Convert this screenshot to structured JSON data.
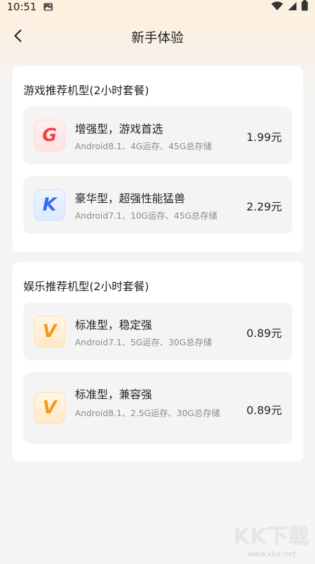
{
  "status_bar": {
    "time": "10:51"
  },
  "header": {
    "title": "新手体验"
  },
  "sections": [
    {
      "title": "游戏推荐机型(2小时套餐)",
      "plans": [
        {
          "icon_letter": "G",
          "icon": "g-badge-icon",
          "name": "增强型，游戏首选",
          "spec": "Android8.1、4G运存、45G总存储",
          "price": "1.99元"
        },
        {
          "icon_letter": "K",
          "icon": "k-badge-icon",
          "name": "豪华型，超强性能猛兽",
          "spec": "Android7.1、10G运存、45G总存储",
          "price": "2.29元"
        }
      ]
    },
    {
      "title": "娱乐推荐机型(2小时套餐)",
      "plans": [
        {
          "icon_letter": "V",
          "icon": "v-badge-icon",
          "name": "标准型，稳定强",
          "spec": "Android7.1、5G运存、30G总存储",
          "price": "0.89元"
        },
        {
          "icon_letter": "V",
          "icon": "v-badge-icon",
          "name": "标准型，兼容强",
          "spec": "Android8.1、2.5G运存、30G总存储",
          "price": "0.89元"
        }
      ]
    }
  ],
  "watermark": {
    "logo": "KK下载",
    "url": "www.kkx.net"
  },
  "colors": {
    "g_badge": "#f0424d",
    "k_badge": "#2f6df6",
    "v_badge": "#f39b18",
    "page_bg": "#f5f5f5"
  }
}
